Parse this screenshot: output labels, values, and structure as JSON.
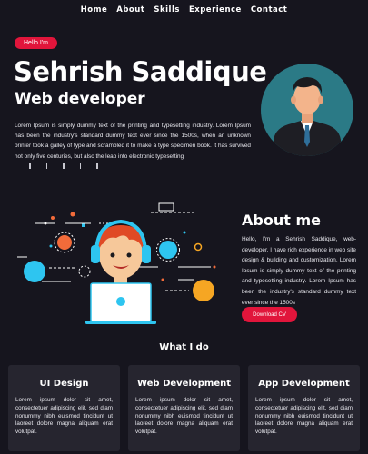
{
  "nav": {
    "items": [
      {
        "label": "Home"
      },
      {
        "label": "About"
      },
      {
        "label": "Skills"
      },
      {
        "label": "Experience"
      },
      {
        "label": "Contact"
      }
    ]
  },
  "hero": {
    "badge": "Hello I'm",
    "name": "Sehrish Saddique",
    "role": "Web developer",
    "text": "Lorem Ipsum is simply dummy text of the printing and typesetting industry. Lorem Ipsum has been the industry's standard dummy text ever since the 1500s, when an unknown printer took a galley of type and scrambled it to make a type specimen book. It has survived not only five centuries, but also the leap into electronic typesetting",
    "pipe_marks": [
      "|",
      "|",
      "|",
      "|",
      "|",
      "|"
    ]
  },
  "about": {
    "title": "About me",
    "text": "Hello, I'm a Sehrish Saddique, web-developer. I have rich experience in web site design & building and customization. Lorem Ipsum is simply dummy text of the printing and typesetting industry. Lorem Ipsum has been the industry's standard dummy text ever since the 1500s",
    "cv_label": "Download CV"
  },
  "services": {
    "heading": "What I do",
    "cards": [
      {
        "title": "UI Design",
        "text": "Lorem ipsum dolor sit amet, consectetuer adipiscing elit, sed diam nonummy nibh euismod tincidunt ut laoreet dolore magna aliquam erat volutpat."
      },
      {
        "title": "Web Development",
        "text": "Lorem ipsum dolor sit amet, consectetuer adipiscing elit, sed diam nonummy nibh euismod tincidunt ut laoreet dolore magna aliquam erat volutpat."
      },
      {
        "title": "App Development",
        "text": "Lorem ipsum dolor sit amet, consectetuer adipiscing elit, sed diam nonummy nibh euismod tincidunt ut laoreet dolore magna aliquam erat volutpat."
      }
    ]
  },
  "colors": {
    "background": "#16151e",
    "accent": "#e1153b",
    "card": "#26252f",
    "avatar_bg": "#2b7a86"
  }
}
